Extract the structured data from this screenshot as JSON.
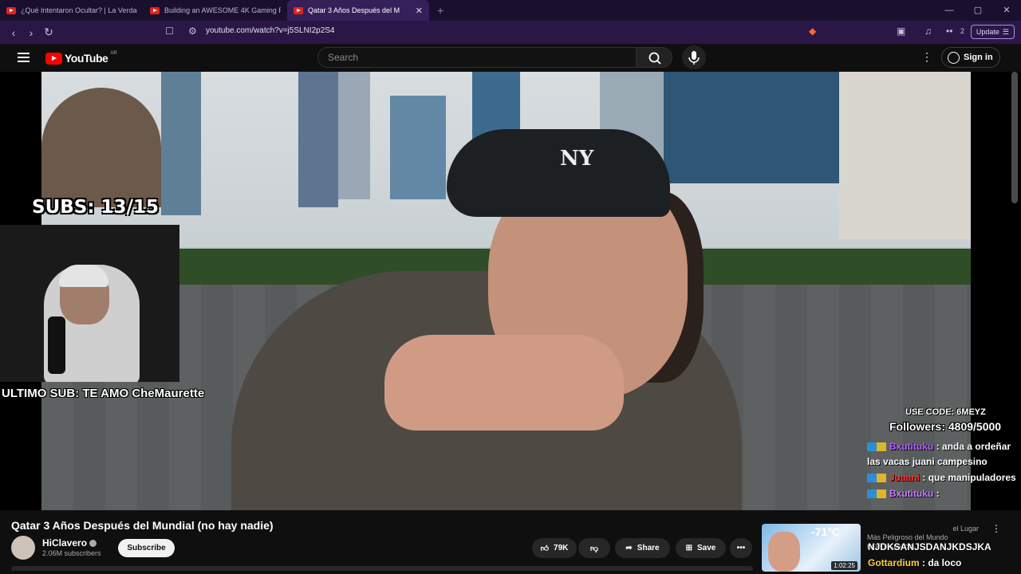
{
  "browser": {
    "tabs": [
      {
        "label": "¿Qué Intentaron Ocultar? | La Verdad"
      },
      {
        "label": "Building an AWESOME 4K Gaming P"
      },
      {
        "label": "Qatar 3 Años Después del M"
      }
    ],
    "url": "youtube.com/watch?v=j5SLNI2p2S4",
    "extension_count": "2",
    "update_label": "Update"
  },
  "youtube": {
    "logo_text": "YouTube",
    "country_code": "AR",
    "search_placeholder": "Search",
    "signin_label": "Sign in"
  },
  "stream_overlay": {
    "subs_goal": "SUBS: 13/15",
    "last_sub": "ULTIMO SUB: TE AMO CheMaurette",
    "code": "USE CODE: 6MEYZ",
    "followers": "Followers: 4809/5000",
    "chat": [
      {
        "user": "Bxutituku",
        "text": ": anda a ordeñar las vacas juani campesino"
      },
      {
        "user": "Juaani",
        "text": ": que manipuladores"
      },
      {
        "user": "Bxutituku",
        "text": ":"
      },
      {
        "user": "",
        "text": "NJDKSANJSDANJKDSJKA"
      },
      {
        "user": "Gottardium",
        "text": ": da loco"
      }
    ]
  },
  "video": {
    "title": "Qatar 3 Años Después del Mundial (no hay nadie)",
    "channel": "HiClavero",
    "subscribers": "2.06M subscribers",
    "subscribe_label": "Subscribe",
    "likes": "79K",
    "share_label": "Share",
    "save_label": "Save"
  },
  "sidebar_video": {
    "thumb_text": "-71°C",
    "duration": "1:02:25",
    "title_fragment": "Más Peligroso del Mundo",
    "title_fragment2": "el Lugar",
    "channel_fragment": "ruben holgado"
  }
}
